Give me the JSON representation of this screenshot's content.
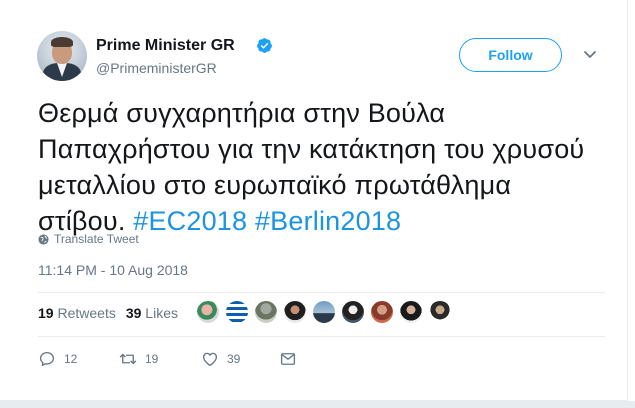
{
  "user": {
    "name": "Prime Minister GR",
    "handle": "@PrimeministerGR"
  },
  "follow_label": "Follow",
  "tweet": {
    "text": "Θερμά συγχαρητήρια στην Βούλα Παπαχρήστου για την κατάκτηση του χρυσού μεταλλίου στο ευρωπαϊκό πρωτάθλημα στίβου.",
    "hashtags": [
      "#EC2018",
      "#Berlin2018"
    ]
  },
  "translate_label": "Translate Tweet",
  "timestamp": "11:14 PM - 10 Aug 2018",
  "stats": {
    "retweets_count": "19",
    "retweets_label": "Retweets",
    "likes_count": "39",
    "likes_label": "Likes"
  },
  "actions": {
    "reply_count": "12",
    "retweet_count": "19",
    "like_count": "39"
  },
  "icons": [
    "verified-badge-icon",
    "chevron-down-icon",
    "globe-icon",
    "reply-icon",
    "retweet-icon",
    "heart-icon",
    "message-icon"
  ],
  "colors": {
    "accent": "#1da1f2",
    "hashtag": "#1b95e0",
    "secondary_text": "#657786",
    "border": "#e6ecf0"
  }
}
